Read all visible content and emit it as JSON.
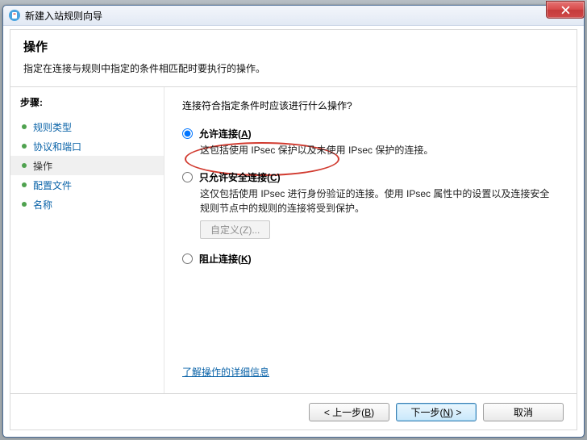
{
  "window": {
    "title": "新建入站规则向导"
  },
  "header": {
    "title": "操作",
    "subtitle": "指定在连接与规则中指定的条件相匹配时要执行的操作。"
  },
  "steps": {
    "label": "步骤:",
    "items": [
      {
        "label": "规则类型"
      },
      {
        "label": "协议和端口"
      },
      {
        "label": "操作"
      },
      {
        "label": "配置文件"
      },
      {
        "label": "名称"
      }
    ],
    "current_index": 2
  },
  "content": {
    "prompt": "连接符合指定条件时应该进行什么操作?",
    "options": [
      {
        "label_pre": "允许连接(",
        "accel": "A",
        "label_post": ")",
        "desc": "这包括使用 IPsec 保护以及未使用 IPsec 保护的连接。",
        "selected": true
      },
      {
        "label_pre": "只允许安全连接(",
        "accel": "C",
        "label_post": ")",
        "desc": "这仅包括使用 IPsec 进行身份验证的连接。使用 IPsec 属性中的设置以及连接安全规则节点中的规则的连接将受到保护。",
        "selected": false,
        "custom_btn": "自定义(Z)..."
      },
      {
        "label_pre": "阻止连接(",
        "accel": "K",
        "label_post": ")",
        "selected": false
      }
    ],
    "learn_more": "了解操作的详细信息"
  },
  "footer": {
    "back_pre": "< 上一步(",
    "back_accel": "B",
    "back_post": ")",
    "next_pre": "下一步(",
    "next_accel": "N",
    "next_post": ") >",
    "cancel": "取消"
  }
}
